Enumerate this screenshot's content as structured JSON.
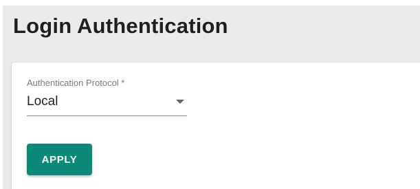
{
  "page": {
    "title": "Login Authentication"
  },
  "form": {
    "protocol_label": "Authentication Protocol *",
    "protocol_value": "Local",
    "apply_label": "APPLY"
  },
  "colors": {
    "accent": "#0c8a77",
    "page_background": "#ebebeb",
    "card_background": "#ffffff"
  },
  "icons": {
    "dropdown": "dropdown-arrow-icon"
  }
}
